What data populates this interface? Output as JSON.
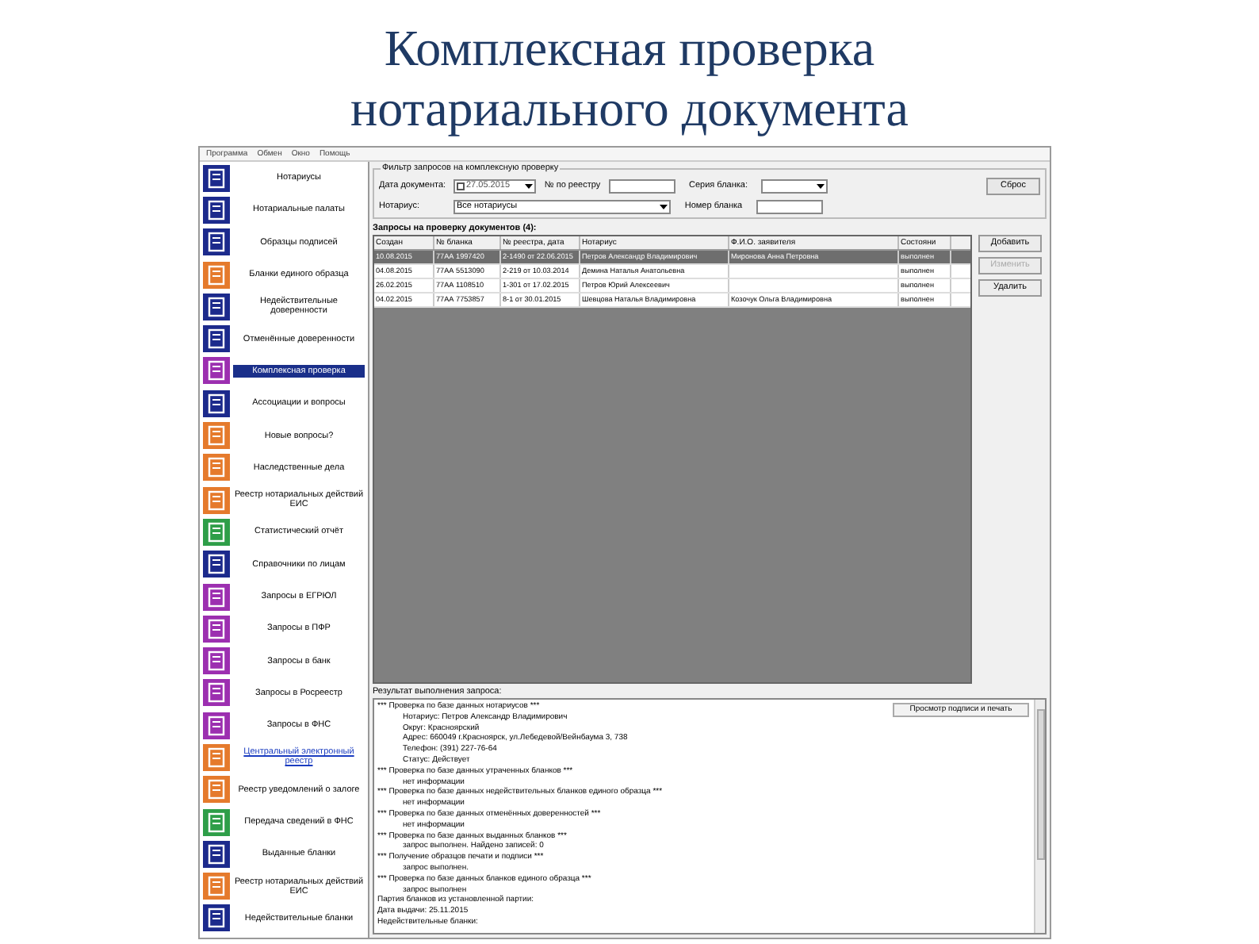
{
  "slide_title": [
    "Комплексная проверка",
    "нотариального документа"
  ],
  "menu": [
    "Программа",
    "Обмен",
    "Окно",
    "Помощь"
  ],
  "sidebar": {
    "items": [
      {
        "label": "Нотариусы",
        "color": "#1c2a8c",
        "selected": false,
        "link": false
      },
      {
        "label": "Нотариальные палаты",
        "color": "#1c2a8c",
        "selected": false,
        "link": false
      },
      {
        "label": "Образцы подписей",
        "color": "#1c2a8c",
        "selected": false,
        "link": false
      },
      {
        "label": "Бланки единого образца",
        "color": "#e57a2c",
        "selected": false,
        "link": false
      },
      {
        "label": "Недействительные доверенности",
        "color": "#1c2a8c",
        "selected": false,
        "link": false
      },
      {
        "label": "Отменённые доверенности",
        "color": "#1c2a8c",
        "selected": false,
        "link": false
      },
      {
        "label": "Комплексная проверка",
        "color": "#9c2fb0",
        "selected": true,
        "link": false
      },
      {
        "label": "Ассоциации и вопросы",
        "color": "#1c2a8c",
        "selected": false,
        "link": false
      },
      {
        "label": "Новые вопросы?",
        "color": "#e57a2c",
        "selected": false,
        "link": false
      },
      {
        "label": "Наследственные дела",
        "color": "#e57a2c",
        "selected": false,
        "link": false
      },
      {
        "label": "Реестр нотариальных действий ЕИС",
        "color": "#e57a2c",
        "selected": false,
        "link": false
      },
      {
        "label": "Статистический отчёт",
        "color": "#2e9e48",
        "selected": false,
        "link": false
      },
      {
        "label": "Справочники по лицам",
        "color": "#1c2a8c",
        "selected": false,
        "link": false
      },
      {
        "label": "Запросы в ЕГРЮЛ",
        "color": "#9c2fb0",
        "selected": false,
        "link": false
      },
      {
        "label": "Запросы в ПФР",
        "color": "#9c2fb0",
        "selected": false,
        "link": false
      },
      {
        "label": "Запросы в банк",
        "color": "#9c2fb0",
        "selected": false,
        "link": false
      },
      {
        "label": "Запросы в Росреестр",
        "color": "#9c2fb0",
        "selected": false,
        "link": false
      },
      {
        "label": "Запросы в ФНС",
        "color": "#9c2fb0",
        "selected": false,
        "link": false
      },
      {
        "label": "Центральный электронный реестр",
        "color": "#e57a2c",
        "selected": false,
        "link": true
      },
      {
        "label": "Реестр уведомлений о залоге",
        "color": "#e57a2c",
        "selected": false,
        "link": false
      },
      {
        "label": "Передача сведений в ФНС",
        "color": "#2e9e48",
        "selected": false,
        "link": false
      },
      {
        "label": "Выданные бланки",
        "color": "#1c2a8c",
        "selected": false,
        "link": false
      },
      {
        "label": "Реестр нотариальных действий ЕИС",
        "color": "#e57a2c",
        "selected": false,
        "link": false
      },
      {
        "label": "Недействительные бланки",
        "color": "#1c2a8c",
        "selected": false,
        "link": false
      }
    ]
  },
  "filter": {
    "title": "Фильтр запросов на комплексную проверку",
    "date_label": "Дата документа:",
    "date_checked": false,
    "date_value": "27.05.2015",
    "registry_label": "№ по реестру",
    "series_label": "Серия бланка:",
    "reset_button": "Сброс",
    "notary_label": "Нотариус:",
    "notary_value": "Все нотариусы",
    "number_label": "Номер бланка"
  },
  "requests": {
    "title": "Запросы на проверку документов (4):",
    "columns": [
      "Создан",
      "№ бланка",
      "№ реестра, дата",
      "Нотариус",
      "Ф.И.О. заявителя",
      "Состояни"
    ],
    "rows": [
      {
        "cells": [
          "10.08.2015",
          "77АА 1997420",
          "2-1490 от 22.06.2015",
          "Петров Александр Владимирович",
          "Миронова Анна Петровна",
          "выполнен"
        ],
        "selected": true
      },
      {
        "cells": [
          "04.08.2015",
          "77АА 5513090",
          "2-219 от 10.03.2014",
          "Демина Наталья Анатольевна",
          "",
          "выполнен"
        ],
        "selected": false
      },
      {
        "cells": [
          "26.02.2015",
          "77АА 1108510",
          "1-301 от 17.02.2015",
          "Петров Юрий Алексеевич",
          "",
          "выполнен"
        ],
        "selected": false
      },
      {
        "cells": [
          "04.02.2015",
          "77АА 7753857",
          "8-1 от 30.01.2015",
          "Шевцова Наталья Владимировна",
          "Козочук Ольга Владимировна",
          "выполнен"
        ],
        "selected": false
      }
    ],
    "buttons": [
      {
        "label": "Добавить",
        "disabled": false
      },
      {
        "label": "Изменить",
        "disabled": true
      },
      {
        "label": "Удалить",
        "disabled": false
      }
    ]
  },
  "result": {
    "title": "Результат выполнения запроса:",
    "button": "Просмотр подписи и печать",
    "lines": [
      {
        "text": "*** Проверка по базе данных нотариусов ***",
        "indent": false
      },
      {
        "text": "Нотариус: Петров Александр Владимирович",
        "indent": true
      },
      {
        "text": "Округ: Красноярский",
        "indent": true
      },
      {
        "text": "Адрес: 660049 г.Красноярск, ул.Лебедевой/Вейнбаума 3, 738",
        "indent": true
      },
      {
        "text": "Телефон: (391) 227-76-64",
        "indent": true
      },
      {
        "text": "Статус: Действует",
        "indent": true
      },
      {
        "text": "*** Проверка по базе данных утраченных бланков ***",
        "indent": false
      },
      {
        "text": "нет информации",
        "indent": true
      },
      {
        "text": "*** Проверка по базе данных недействительных бланков единого образца ***",
        "indent": false
      },
      {
        "text": "нет информации",
        "indent": true
      },
      {
        "text": "*** Проверка по базе данных отменённых доверенностей ***",
        "indent": false
      },
      {
        "text": "нет информации",
        "indent": true
      },
      {
        "text": "*** Проверка по базе данных выданных бланков ***",
        "indent": false
      },
      {
        "text": "запрос выполнен. Найдено записей: 0",
        "indent": true
      },
      {
        "text": "*** Получение образцов печати и подписи ***",
        "indent": false
      },
      {
        "text": "запрос выполнен.",
        "indent": true
      },
      {
        "text": "*** Проверка по базе данных бланков единого образца ***",
        "indent": false
      },
      {
        "text": "запрос выполнен",
        "indent": true
      },
      {
        "text": "Партия бланков из установленной партии:",
        "indent": false
      },
      {
        "text": "Дата выдачи: 25.11.2015",
        "indent": false
      },
      {
        "text": "Недействительные бланки:",
        "indent": false
      }
    ]
  }
}
